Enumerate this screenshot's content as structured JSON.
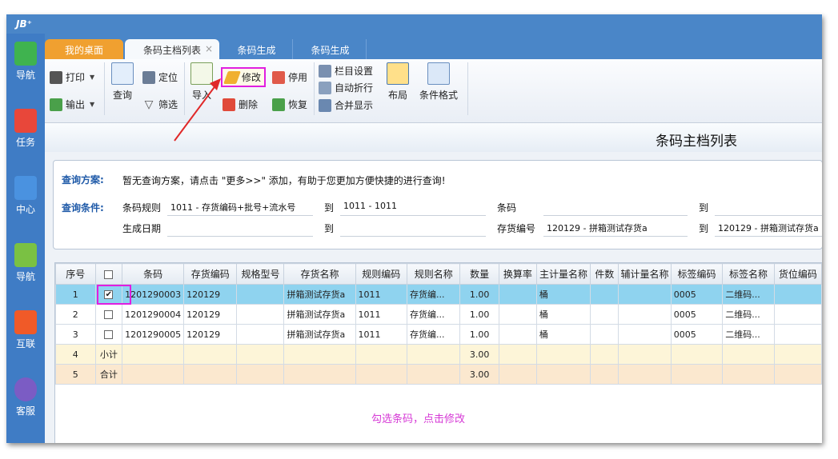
{
  "app": {
    "title": "JB⁺"
  },
  "nav": [
    {
      "label": "导航",
      "color": "#3fb34f",
      "icon": "home-icon"
    },
    {
      "label": "任务",
      "color": "#e8473a",
      "icon": "task-icon"
    },
    {
      "label": "中心",
      "color": "#4a92e0",
      "icon": "doc-icon"
    },
    {
      "label": "导航",
      "color": "#7ac143",
      "icon": "compass-icon"
    },
    {
      "label": "互联",
      "color": "#f05a28",
      "icon": "link-icon"
    },
    {
      "label": "客服",
      "color": "#7b5cc4",
      "icon": "service-icon"
    }
  ],
  "tabs": {
    "desktop": "我的桌面",
    "list": "条码主档列表",
    "close": "×",
    "gen1": "条码生成",
    "gen2": "条码生成"
  },
  "toolbar": {
    "print": "打印",
    "export": "输出",
    "query": "查询",
    "locate": "定位",
    "filter": "筛选",
    "import": "导入",
    "edit": "修改",
    "delete": "删除",
    "disable": "停用",
    "restore": "恢复",
    "column_settings": "栏目设置",
    "auto_wrap": "自动折行",
    "merge_display": "合并显示",
    "layout": "布局",
    "condition_format": "条件格式"
  },
  "page_title": "条码主档列表",
  "query": {
    "scheme_label": "查询方案:",
    "scheme_text": "暂无查询方案，请点击 \"更多>>\" 添加，有助于您更加方便快捷的进行查询!",
    "cond_label": "查询条件:",
    "rule_label": "条码规则",
    "rule_from": "1011 - 存货编码+批号+流水号",
    "to1": "到",
    "rule_to": "1011 - 1011",
    "barcode_label": "条码",
    "to2": "到",
    "date_label": "生成日期",
    "to3": "到",
    "inv_label": "存货编号",
    "inv_from": "120129 - 拼箱测试存货a",
    "to4": "到",
    "inv_to": "120129 - 拼箱测试存货a"
  },
  "grid": {
    "headers": [
      "序号",
      "",
      "条码",
      "存货编码",
      "规格型号",
      "存货名称",
      "规则编码",
      "规则名称",
      "数量",
      "换算率",
      "主计量名称",
      "件数",
      "辅计量名称",
      "标签编码",
      "标签名称",
      "货位编码"
    ],
    "rows": [
      [
        "1",
        "✔",
        "1201290003",
        "120129",
        "",
        "拼箱测试存货a",
        "1011",
        "存货编...",
        "1.00",
        "",
        "桶",
        "",
        "",
        "0005",
        "二维码...",
        ""
      ],
      [
        "2",
        "",
        "1201290004",
        "120129",
        "",
        "拼箱测试存货a",
        "1011",
        "存货编...",
        "1.00",
        "",
        "桶",
        "",
        "",
        "0005",
        "二维码...",
        ""
      ],
      [
        "3",
        "",
        "1201290005",
        "120129",
        "",
        "拼箱测试存货a",
        "1011",
        "存货编...",
        "1.00",
        "",
        "桶",
        "",
        "",
        "0005",
        "二维码...",
        ""
      ],
      [
        "4",
        "小计",
        "",
        "",
        "",
        "",
        "",
        "",
        "3.00",
        "",
        "",
        "",
        "",
        "",
        "",
        ""
      ],
      [
        "5",
        "合计",
        "",
        "",
        "",
        "",
        "",
        "",
        "3.00",
        "",
        "",
        "",
        "",
        "",
        "",
        ""
      ]
    ]
  },
  "annotation": "勾选条码，点击修改",
  "colors": {
    "accent": "#4a86c8",
    "highlight": "#e01ee0",
    "selected_row": "#8fd3ef",
    "annotation": "#d63ad6"
  }
}
